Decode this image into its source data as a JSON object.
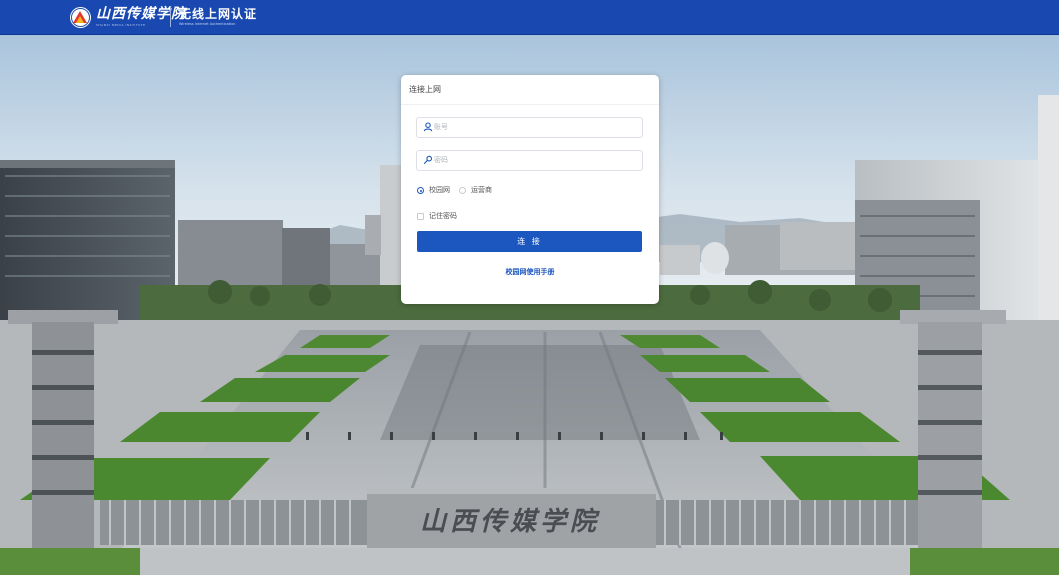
{
  "header": {
    "school_name": "山西传媒学院",
    "school_name_en": "SHANXI MEDIA INSTITUTE",
    "system_title": "无线上网认证",
    "system_subtitle": "Wireless Internet Authentication"
  },
  "login": {
    "card_title": "连接上网",
    "account_placeholder": "账号",
    "password_placeholder": "密码",
    "network_options": [
      {
        "label": "校园网",
        "selected": true
      },
      {
        "label": "运营商",
        "selected": false
      }
    ],
    "remember_label": "记住密码",
    "remember_checked": false,
    "connect_label": "连 接",
    "manual_link": "校园网使用手册"
  },
  "gate": {
    "inscription": "山西传媒学院"
  },
  "colors": {
    "header_bg": "#1848b0",
    "primary": "#1c56bf",
    "card_bg": "#ffffff"
  },
  "icons": {
    "account": "user-icon",
    "password": "key-icon"
  }
}
